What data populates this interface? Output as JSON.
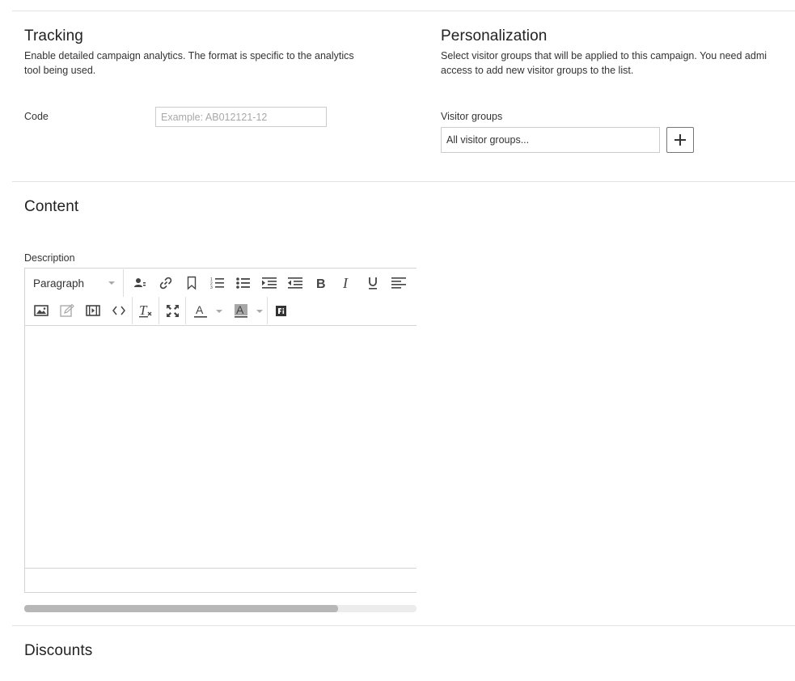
{
  "tracking": {
    "title": "Tracking",
    "description_line1": "Enable detailed campaign analytics. The format is specific to the analytics",
    "description_line2": "tool being used.",
    "code_label": "Code",
    "code_placeholder": "Example: AB012121-12",
    "code_value": ""
  },
  "personalization": {
    "title": "Personalization",
    "description_line1": "Select visitor groups that will be applied to this campaign. You need admi",
    "description_line2": "access to add new visitor groups to the list.",
    "visitor_groups_label": "Visitor groups",
    "visitor_groups_value": "All visitor groups...",
    "add_button_icon": "plus-icon"
  },
  "content": {
    "title": "Content",
    "description_label": "Description",
    "editor": {
      "format_select": "Paragraph",
      "toolbar_row1_icons": [
        "personalized-content-icon",
        "link-icon",
        "bookmark-icon",
        "numbered-list-icon",
        "bulleted-list-icon",
        "indent-icon",
        "outdent-icon",
        "bold-icon",
        "italic-icon",
        "underline-icon",
        "align-left-icon"
      ],
      "toolbar_row2_icons": [
        "insert-image-icon",
        "edit-image-icon",
        "insert-media-icon",
        "source-code-icon",
        "clear-formatting-icon",
        "fullscreen-icon",
        "text-color-icon",
        "background-color-icon",
        "insert-block-icon"
      ],
      "horizontal_scroll_fraction": 0.8
    }
  },
  "discounts": {
    "title": "Discounts"
  }
}
